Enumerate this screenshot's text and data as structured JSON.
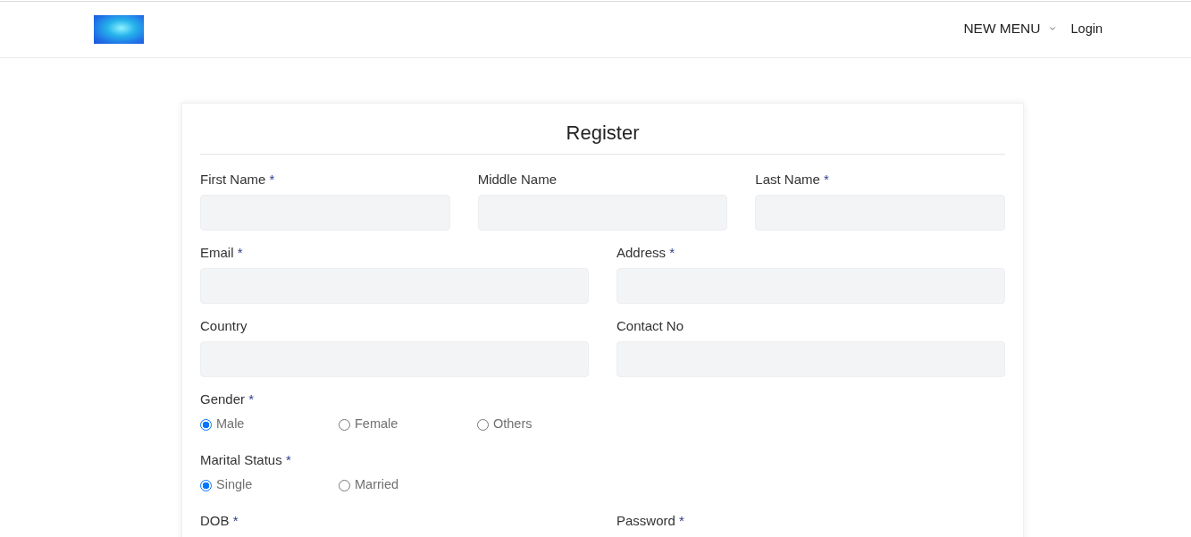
{
  "nav": [
    {
      "label": "NEW MENU",
      "kind": "dropdown"
    },
    {
      "label": "Login",
      "kind": "link"
    }
  ],
  "form": {
    "title": "Register",
    "rows": [
      {
        "kind": "fields",
        "fields": [
          {
            "label": "First Name",
            "required_mark": "*"
          },
          {
            "label": "Middle Name"
          },
          {
            "label": "Last Name",
            "required_mark": "*"
          }
        ]
      },
      {
        "kind": "fields",
        "fields": [
          {
            "label": "Email",
            "required_mark": "*"
          },
          {
            "label": "Address",
            "required_mark": "*"
          }
        ]
      },
      {
        "kind": "fields",
        "fields": [
          {
            "label": "Country"
          },
          {
            "label": "Contact No"
          }
        ]
      },
      {
        "kind": "radios",
        "label": "Gender",
        "required_mark": "*",
        "options": [
          {
            "label": "Male",
            "selected": true
          },
          {
            "label": "Female",
            "selected": false
          },
          {
            "label": "Others",
            "selected": false
          }
        ]
      },
      {
        "kind": "radios",
        "label": "Marital Status",
        "required_mark": "*",
        "options": [
          {
            "label": "Single",
            "selected": true
          },
          {
            "label": "Married",
            "selected": false
          }
        ]
      },
      {
        "kind": "labels",
        "fields": [
          {
            "label": "DOB",
            "required_mark": "*"
          },
          {
            "label": "Password",
            "required_mark": "*"
          }
        ]
      }
    ]
  }
}
